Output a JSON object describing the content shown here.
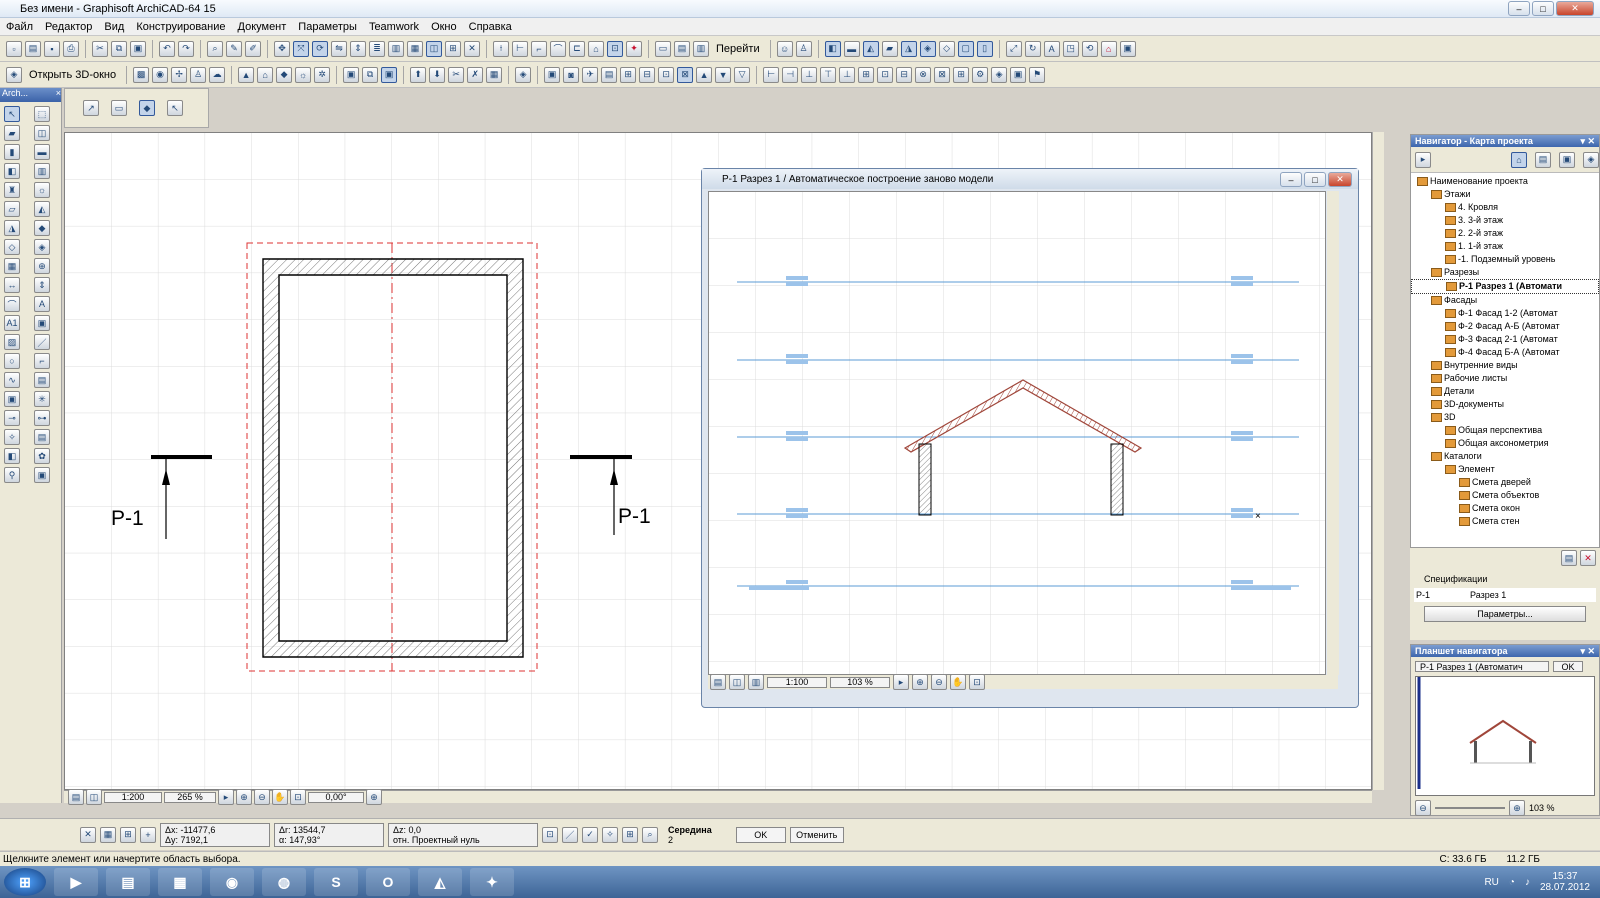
{
  "window": {
    "title": "Без имени - Graphisoft ArchiCAD-64 15"
  },
  "menu": [
    "Файл",
    "Редактор",
    "Вид",
    "Конструирование",
    "Документ",
    "Параметры",
    "Teamwork",
    "Окно",
    "Справка"
  ],
  "toolbar": {
    "goto_label": "Перейти",
    "open3d_label": "Открыть 3D-окно"
  },
  "toolbox": {
    "title": "Arch..."
  },
  "canvas": {
    "marker_label": "Р-1",
    "scale": "1:200",
    "zoom": "265 %",
    "angle": "0,00°"
  },
  "section_window": {
    "title": "Р-1 Разрез 1 / Автоматическое построение заново модели",
    "scale": "1:100",
    "zoom": "103 %"
  },
  "navigator": {
    "title": "Навигатор - Карта проекта",
    "items": [
      {
        "label": "Наименование проекта",
        "level": 0
      },
      {
        "label": "Этажи",
        "level": 1
      },
      {
        "label": "4. Кровля",
        "level": 2
      },
      {
        "label": "3. 3-й этаж",
        "level": 2
      },
      {
        "label": "2. 2-й этаж",
        "level": 2
      },
      {
        "label": "1. 1-й этаж",
        "level": 2
      },
      {
        "label": "-1. Подземный уровень",
        "level": 2
      },
      {
        "label": "Разрезы",
        "level": 1
      },
      {
        "label": "Р-1 Разрез 1 (Автомати",
        "level": 2,
        "selected": true
      },
      {
        "label": "Фасады",
        "level": 1
      },
      {
        "label": "Ф-1 Фасад 1-2 (Автомат",
        "level": 2
      },
      {
        "label": "Ф-2 Фасад А-Б (Автомат",
        "level": 2
      },
      {
        "label": "Ф-3 Фасад 2-1 (Автомат",
        "level": 2
      },
      {
        "label": "Ф-4 Фасад Б-А (Автомат",
        "level": 2
      },
      {
        "label": "Внутренние виды",
        "level": 1
      },
      {
        "label": "Рабочие листы",
        "level": 1
      },
      {
        "label": "Детали",
        "level": 1
      },
      {
        "label": "3D-документы",
        "level": 1
      },
      {
        "label": "3D",
        "level": 1
      },
      {
        "label": "Общая перспектива",
        "level": 2
      },
      {
        "label": "Общая аксонометрия",
        "level": 2
      },
      {
        "label": "Каталоги",
        "level": 1
      },
      {
        "label": "Элемент",
        "level": 2
      },
      {
        "label": "Смета дверей",
        "level": 3
      },
      {
        "label": "Смета объектов",
        "level": 3
      },
      {
        "label": "Смета окон",
        "level": 3
      },
      {
        "label": "Смета стен",
        "level": 3
      }
    ]
  },
  "specs": {
    "header": "Спецификации",
    "id": "Р-1",
    "name": "Разрез 1",
    "params_button": "Параметры..."
  },
  "mini_nav": {
    "title": "Планшет навигатора",
    "view": "Р-1 Разрез 1 (Автоматич",
    "ok": "OK",
    "zoom": "103 %"
  },
  "coords": {
    "dx": "Δx: -11477,6",
    "dy": "Δy: 7192,1",
    "dr": "Δr: 13544,7",
    "da": "α: 147,93°",
    "dz": "Δz: 0,0",
    "rel": "отн. Проектный нуль",
    "snap": "Середина",
    "snap_n": "2",
    "ok": "OK",
    "cancel": "Отменить"
  },
  "status": {
    "text": "Щелкните элемент или начертите область выбора.",
    "disk_c": "C: 33.6 ГБ",
    "mem": "11.2 ГБ"
  },
  "taskbar": {
    "lang": "RU",
    "time": "15:37",
    "date": "28.07.2012"
  },
  "colors": {
    "level_line": "#5b9bd5",
    "roof": "#a0463a",
    "selection": "#d33"
  }
}
